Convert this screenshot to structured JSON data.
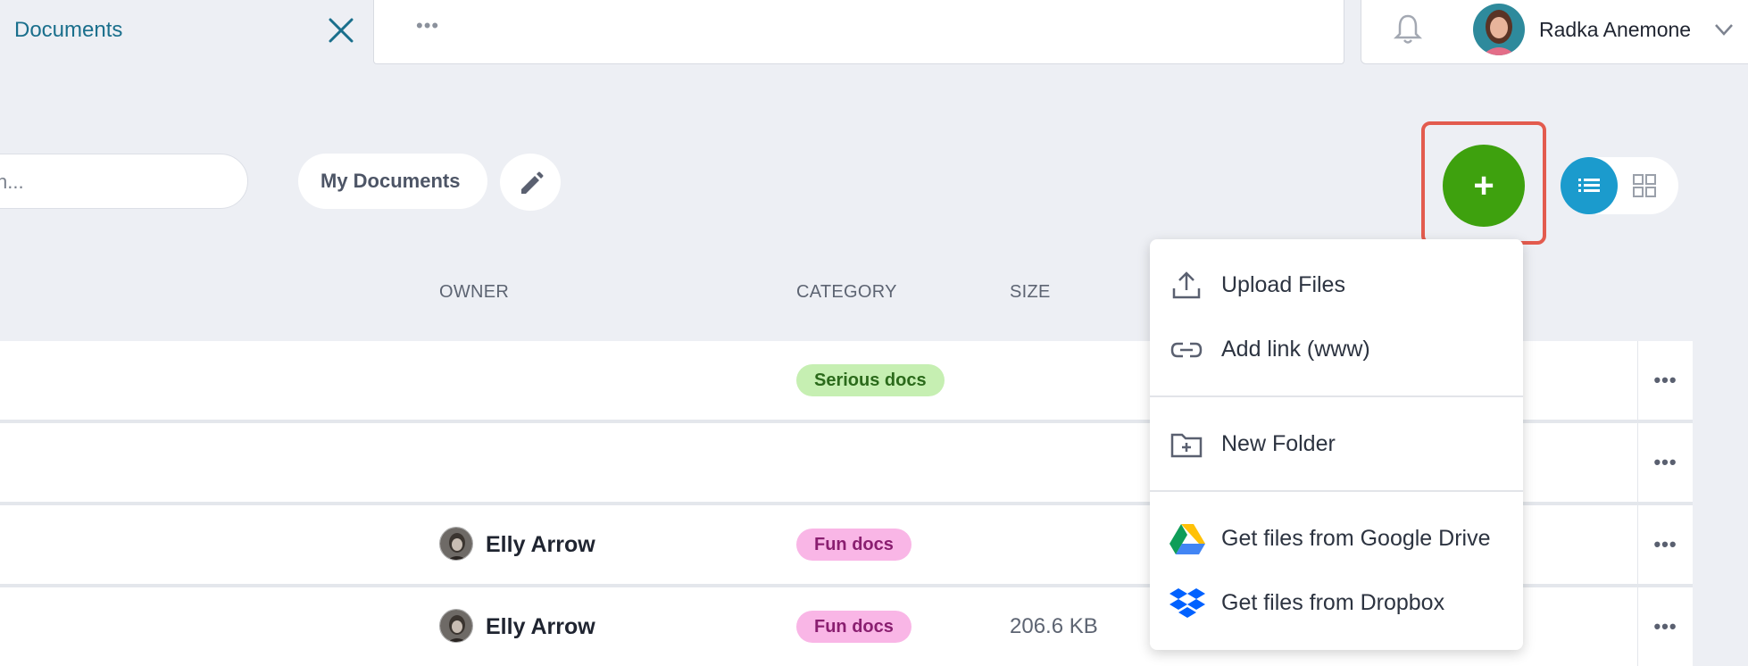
{
  "header": {
    "tab_title": "Documents",
    "more_label": "•••",
    "user_name": "Radka Anemone"
  },
  "toolbar": {
    "search_placeholder": "h...",
    "folder_label": "My Documents",
    "add_label": "+"
  },
  "table": {
    "columns": [
      "OWNER",
      "CATEGORY",
      "SIZE"
    ],
    "rows": [
      {
        "owner": "",
        "category": "Serious docs",
        "size": "",
        "more": "•••"
      },
      {
        "owner": "",
        "category": "",
        "size": "",
        "more": "•••"
      },
      {
        "owner": "Elly Arrow",
        "category": "Fun docs",
        "size": "",
        "more": "•••"
      },
      {
        "owner": "Elly Arrow",
        "category": "Fun docs",
        "size": "206.6 KB",
        "more": "•••"
      }
    ]
  },
  "add_menu": {
    "items": [
      {
        "label": "Upload Files",
        "icon": "upload-icon"
      },
      {
        "label": "Add link (www)",
        "icon": "link-icon"
      },
      {
        "label": "New Folder",
        "icon": "new-folder-icon"
      },
      {
        "label": "Get files from Google Drive",
        "icon": "google-drive-icon"
      },
      {
        "label": "Get files from Dropbox",
        "icon": "dropbox-icon"
      }
    ]
  },
  "colors": {
    "accent_teal": "#1a6f8c",
    "add_green": "#3ea10e",
    "highlight_red": "#e35b4e",
    "view_active_blue": "#1b9bcd"
  }
}
